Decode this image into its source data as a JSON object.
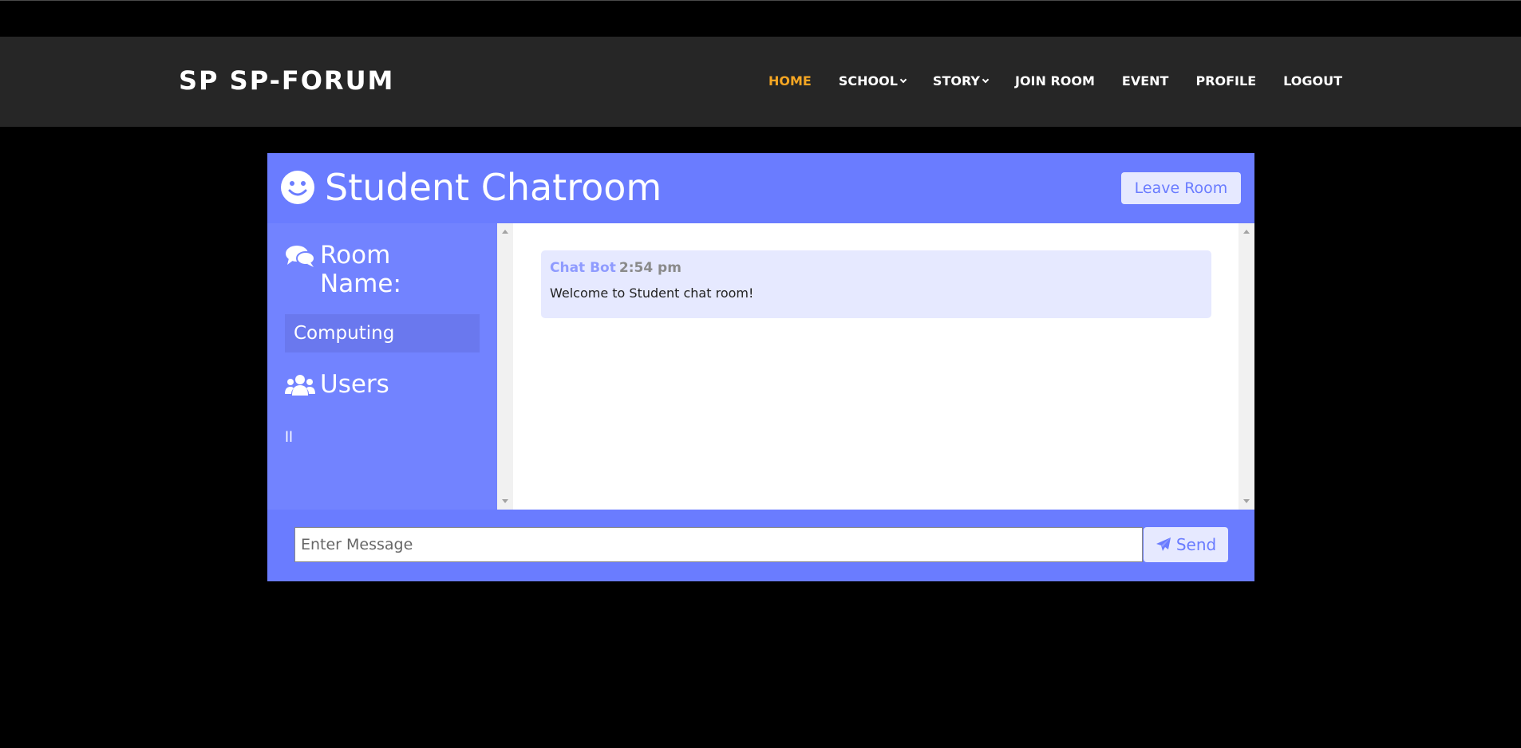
{
  "brand": "SP SP-FORUM",
  "nav": {
    "home": "HOME",
    "school": "SCHOOL",
    "story": "STORY",
    "join_room": "JOIN ROOM",
    "event": "EVENT",
    "profile": "PROFILE",
    "logout": "LOGOUT"
  },
  "chat": {
    "title": "Student Chatroom",
    "leave_label": "Leave Room",
    "room_heading": "Room Name:",
    "room_name": "Computing",
    "users_heading": "Users",
    "users": "ll",
    "messages": [
      {
        "author": "Chat Bot",
        "time": "2:54 pm",
        "text": "Welcome to Student chat room!"
      }
    ],
    "input_placeholder": "Enter Message",
    "send_label": "Send"
  },
  "colors": {
    "accent": "#6a7cff",
    "active_nav": "#f5a623",
    "navbar_bg": "#262626"
  }
}
